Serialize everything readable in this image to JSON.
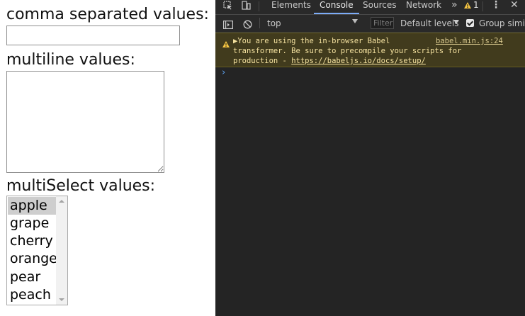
{
  "app": {
    "labels": {
      "csv": "comma separated values:",
      "multiline": "multiline values:",
      "multiselect": "multiSelect values:"
    },
    "csv_input": {
      "value": ""
    },
    "multiline_input": {
      "value": ""
    },
    "multiselect": {
      "options": [
        "apple",
        "grape",
        "cherry",
        "orange",
        "pear",
        "peach"
      ],
      "selected": "apple"
    }
  },
  "devtools": {
    "tabs": [
      "Elements",
      "Console",
      "Sources",
      "Network"
    ],
    "active_tab": "Console",
    "more_tabs_glyph": "»",
    "warning_count": "1",
    "toolbar": {
      "context": "top",
      "filter_placeholder": "Filter",
      "levels": "Default levels",
      "group_similar": "Group simila"
    },
    "console": {
      "warning": {
        "line1": "You are using the in-browser Babel",
        "line2": "transformer. Be sure to precompile your scripts for",
        "line3_prefix": "production - ",
        "link": "https://babeljs.io/docs/setup/",
        "source": "babel.min.js:24"
      },
      "prompt": "›"
    },
    "icons": [
      "inspect-icon",
      "device-toolbar-icon",
      "warning-icon",
      "kebab-menu-icon",
      "close-icon",
      "sidebar-toggle-icon",
      "clear-console-icon"
    ],
    "colors": {
      "accent": "#7cacf8",
      "warning_bg": "#413b1d",
      "warning_text": "#f5e2a0",
      "panel_bg": "#242424"
    }
  }
}
